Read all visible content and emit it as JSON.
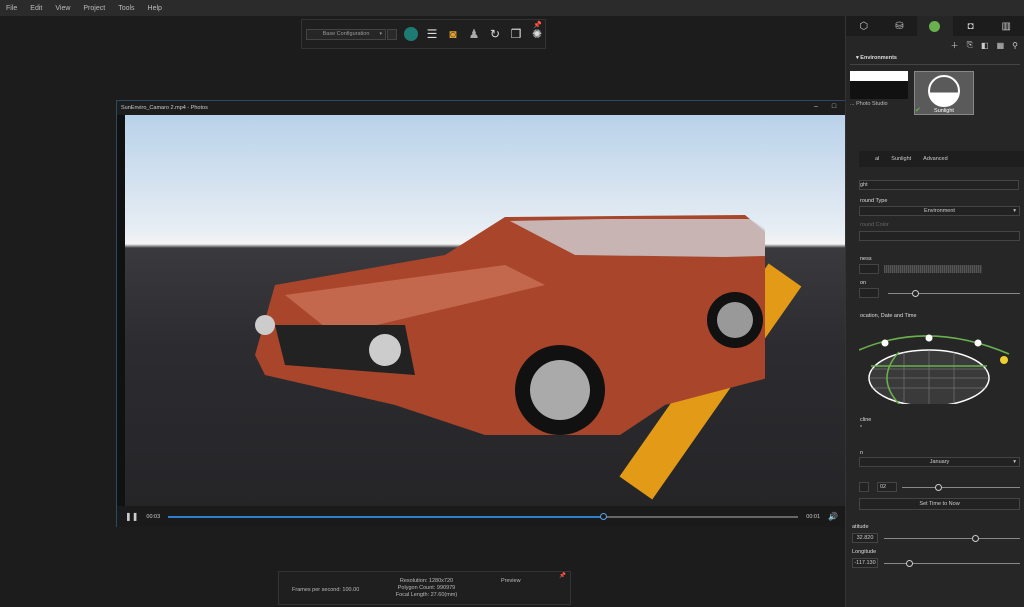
{
  "menu": [
    "File",
    "Edit",
    "View",
    "Project",
    "Tools",
    "Help"
  ],
  "toolbar": {
    "configuration": "Base Configuration"
  },
  "window": {
    "title": "SunEnviro_Camaro 2.mp4 - Photos",
    "minimize": "–",
    "maximize": "□",
    "close": "✕"
  },
  "player": {
    "elapsed": "00:03",
    "remaining": "00:01",
    "progress_percent": 69
  },
  "panel": {
    "section": "Environments",
    "environments": [
      {
        "label": "... Photo Studio"
      },
      {
        "label": "Sunlight",
        "selected": true
      }
    ],
    "tabs": [
      "al",
      "Sunlight",
      "Advanced"
    ],
    "name_value": "ght",
    "background_type_label": "round Type",
    "background_type_value": "Environment",
    "background_color_label": "round Color",
    "brightness_label": "ness",
    "rotation_label": "on",
    "location_label": "ocation, Date and Time",
    "decline_label": "cline",
    "decline_value": "°",
    "month_label": "n",
    "month_value": "January",
    "hour_value": "02",
    "set_time_button": "Set Time to Now",
    "latitude_label": "atitude",
    "latitude_value": "32.820",
    "longitude_label": "Longitude",
    "longitude_value": "-117.130"
  },
  "info": {
    "fps": "Frames per second: 100.00",
    "resolution": "Resolution: 1280x720",
    "polygons": "Polygon Count: 990979",
    "focal": "Focal Length: 27.60(mm)",
    "preview": "Preview"
  },
  "colors": {
    "accent": "#2f7fd0",
    "sun_path": "#6ab04c",
    "sun": "#f0d030",
    "stripe": "#e39a17",
    "car": "#b04a2a"
  }
}
